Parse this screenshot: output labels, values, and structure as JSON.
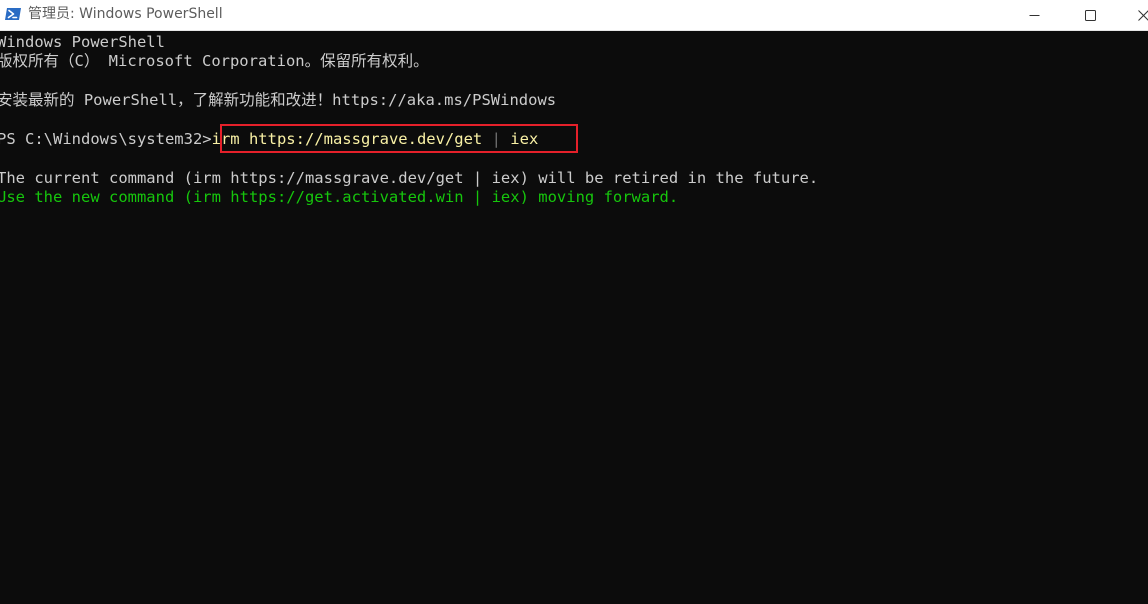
{
  "window": {
    "title": "管理员: Windows PowerShell",
    "icon": "powershell-icon",
    "controls": [
      "minimize-icon",
      "maximize-icon",
      "close-icon"
    ]
  },
  "console": {
    "lines": [
      "Windows PowerShell",
      "版权所有（C） Microsoft Corporation。保留所有权利。",
      "安装最新的 PowerShell，了解新功能和改进！https://aka.ms/PSWindows"
    ],
    "prompt": "PS C:\\Windows\\system32>",
    "command": {
      "part1": "irm https://massgrave.dev/get ",
      "pipe": "|",
      "part2": " iex"
    },
    "output": [
      "The current command (irm https://massgrave.dev/get | iex) will be retired in the future.",
      "Use the new command (irm https://get.activated.win | iex) moving forward."
    ]
  },
  "colors": {
    "background": "#0c0c0c",
    "text": "#cccccc",
    "command": "#f9f1a5",
    "green_output": "#16c60c",
    "highlight_border": "#e5202a"
  }
}
